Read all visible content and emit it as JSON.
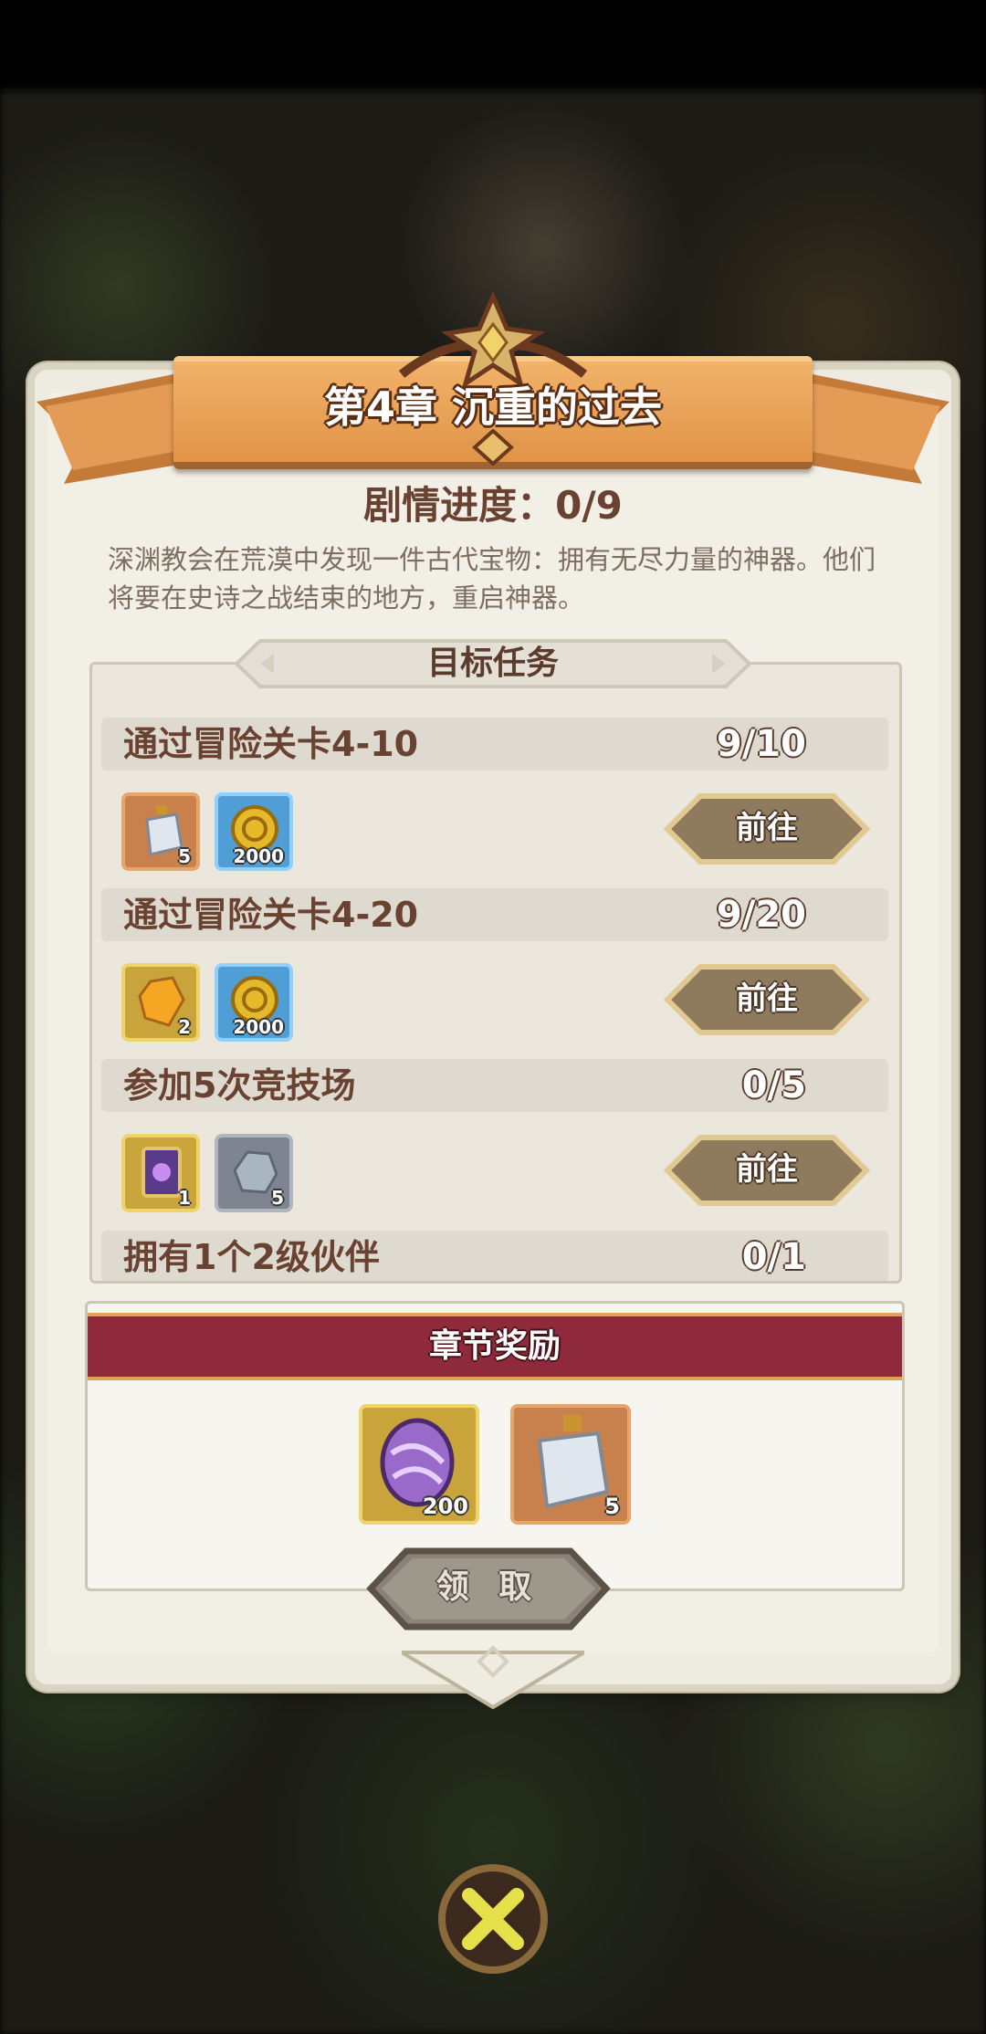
{
  "header": {
    "chapter_title": "第4章 沉重的过去",
    "progress_label": "剧情进度：0/9",
    "description": "深渊教会在荒漠中发现一件古代宝物：拥有无尽力量的神器。他们将要在史诗之战结束的地方，重启神器。"
  },
  "tasks": {
    "section_title": "目标任务",
    "items": [
      {
        "name": "通过冒险关卡4-10",
        "count": "9/10",
        "progress": 0.9,
        "rewards": [
          {
            "icon": "potion-bottle-icon",
            "count": "5",
            "frame": "orange"
          },
          {
            "icon": "gold-coin-icon",
            "count": "2000",
            "frame": "blue"
          }
        ],
        "button_label": "前往"
      },
      {
        "name": "通过冒险关卡4-20",
        "count": "9/20",
        "progress": 0.45,
        "rewards": [
          {
            "icon": "amber-crystal-icon",
            "count": "2",
            "frame": "gold"
          },
          {
            "icon": "gold-coin-icon",
            "count": "2000",
            "frame": "blue"
          }
        ],
        "button_label": "前往"
      },
      {
        "name": "参加5次竞技场",
        "count": "0/5",
        "progress": 0,
        "rewards": [
          {
            "icon": "magic-scroll-icon",
            "count": "1",
            "frame": "gold"
          },
          {
            "icon": "stone-ore-icon",
            "count": "5",
            "frame": "grey"
          }
        ],
        "button_label": "前往"
      },
      {
        "name": "拥有1个2级伙伴",
        "count": "0/1",
        "progress": 0
      }
    ]
  },
  "chapter_rewards": {
    "title": "章节奖励",
    "items": [
      {
        "icon": "purple-spirit-stone-icon",
        "count": "200",
        "frame": "gold"
      },
      {
        "icon": "potion-bottle-icon",
        "count": "5",
        "frame": "orange"
      }
    ],
    "claim_label": "领 取"
  },
  "colors": {
    "banner": "#e09447",
    "rewards_header": "#8e2a3c",
    "parchment": "#eeebe0",
    "title_brown": "#6a4232"
  }
}
